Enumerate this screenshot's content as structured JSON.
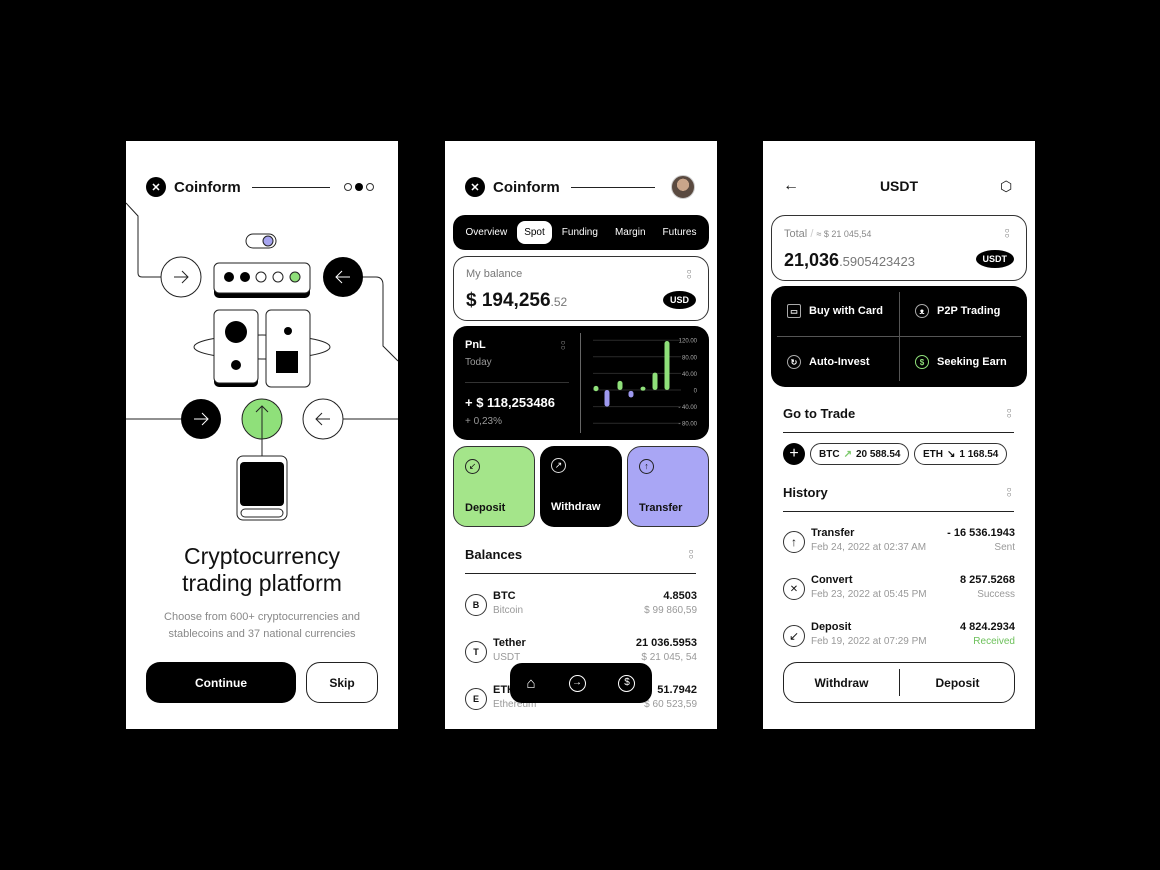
{
  "brand": "Coinform",
  "screen1": {
    "title": "Cryptocurrency trading platform",
    "title_line1": "Cryptocurrency",
    "title_line2": "trading platform",
    "subtitle_line1": "Choose from 600+ cryptocurrencies and",
    "subtitle_line2": "stablecoins and 37 national currencies",
    "continue_label": "Continue",
    "skip_label": "Skip",
    "page_indicator": {
      "total": 3,
      "active": 2
    },
    "accent": "#8fe07a",
    "toggle_color": "#a6a4f0"
  },
  "screen2": {
    "tabs": [
      "Overview",
      "Spot",
      "Funding",
      "Margin",
      "Futures"
    ],
    "active_tab": "Spot",
    "balance": {
      "label": "My balance",
      "main": "$ 194,256",
      "decimals": ".52",
      "currency": "USD"
    },
    "pnl": {
      "label": "PnL",
      "period": "Today",
      "value": "+ $ 118,253486",
      "change": "+ 0,23%"
    },
    "actions": [
      {
        "label": "Deposit",
        "color": "#a4e58a",
        "icon": "arrow-down-left-icon"
      },
      {
        "label": "Withdraw",
        "color": "#000000",
        "icon": "arrow-up-right-icon"
      },
      {
        "label": "Transfer",
        "color": "#a9a6f5",
        "icon": "arrow-up-icon"
      }
    ],
    "balances_title": "Balances",
    "balances": [
      {
        "icon": "B",
        "symbol": "BTC",
        "name": "Bitcoin",
        "amount": "4.8503",
        "usd": "$ 99 860,59"
      },
      {
        "icon": "T",
        "symbol": "Tether",
        "name": "USDT",
        "amount": "21 036.5953",
        "usd": "$ 21 045, 54"
      },
      {
        "icon": "E",
        "symbol": "ETH",
        "name": "Ethereum",
        "amount": "51.7942",
        "usd": "$ 60 523,59"
      }
    ],
    "bottom_nav": [
      "home-icon",
      "transfer-icon",
      "dollar-icon"
    ]
  },
  "chart_data": {
    "type": "bar",
    "ylim": [
      -80,
      120
    ],
    "yticks": [
      "120.00",
      "80.00",
      "40.00",
      "0",
      "- 40.00",
      "- 80.00"
    ],
    "ytick_values": [
      120,
      80,
      40,
      0,
      -40,
      -80
    ],
    "bars": [
      {
        "low": -3,
        "high": 10,
        "dir": "up"
      },
      {
        "low": -40,
        "high": 0,
        "dir": "down"
      },
      {
        "low": 0,
        "high": 22,
        "dir": "up"
      },
      {
        "low": -18,
        "high": -2,
        "dir": "down"
      },
      {
        "low": 0,
        "high": 8,
        "dir": "up"
      },
      {
        "low": 0,
        "high": 42,
        "dir": "up"
      },
      {
        "low": 0,
        "high": 118,
        "dir": "up"
      }
    ],
    "colors": {
      "up": "#8fe07a",
      "down": "#9d98ee"
    },
    "grid": true
  },
  "screen3": {
    "title": "USDT",
    "total_label": "Total",
    "total_usd": "≈ $ 21 045,54",
    "total_main": "21,036",
    "total_decimals": ".5905423423",
    "currency": "USDT",
    "actions": [
      {
        "label": "Buy with Card",
        "icon": "card-icon"
      },
      {
        "label": "P2P Trading",
        "icon": "user-icon"
      },
      {
        "label": "Auto-Invest",
        "icon": "refresh-icon"
      },
      {
        "label": "Seeking Earn",
        "icon": "dollar-icon"
      }
    ],
    "trade_title": "Go to Trade",
    "trade_chips": [
      {
        "symbol": "BTC",
        "arrow": "↗",
        "price": "20 588.54",
        "color": "#7bc96a"
      },
      {
        "symbol": "ETH",
        "arrow": "↘",
        "price": "1 168.54",
        "color": "#333333"
      }
    ],
    "history_title": "History",
    "history": [
      {
        "icon": "↑",
        "type": "Transfer",
        "date": "Feb 24, 2022 at 02:37 AM",
        "amount": "- 16 536.1943",
        "status": "Sent"
      },
      {
        "icon": "✕",
        "type": "Convert",
        "date": "Feb 23, 2022 at 05:45 PM",
        "amount": "8 257.5268",
        "status": "Success"
      },
      {
        "icon": "↙",
        "type": "Deposit",
        "date": "Feb 19, 2022 at 07:29 PM",
        "amount": "4 824.2934",
        "status": "Received"
      }
    ],
    "received_color": "#6cc05a",
    "withdraw_label": "Withdraw",
    "deposit_label": "Deposit"
  }
}
